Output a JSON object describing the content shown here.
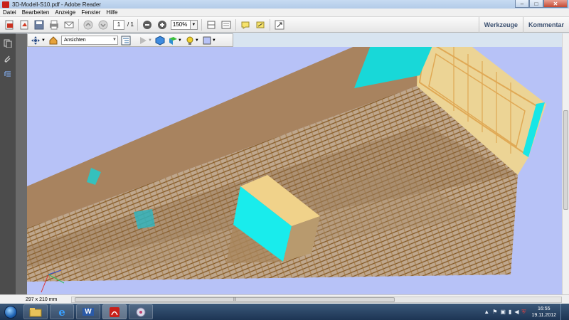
{
  "window": {
    "title": "3D-Modell-S10.pdf - Adobe Reader"
  },
  "menu": [
    "Datei",
    "Bearbeiten",
    "Anzeige",
    "Fenster",
    "Hilfe"
  ],
  "toolbar": {
    "page_current": "1",
    "page_total": "/ 1",
    "zoom": "150%",
    "tools_label": "Werkzeuge",
    "comment_label": "Kommentar"
  },
  "toolbar3d": {
    "views_label": "Ansichten"
  },
  "status": {
    "page_size": "297 x 210 mm"
  },
  "taskbar": {
    "time": "16:55",
    "date": "19.11.2012"
  },
  "colors": {
    "viewport_bg": "#b7c2f7",
    "concrete": "#c4a074",
    "rebar": "#8a5a20",
    "cyan_face": "#18e6e6",
    "taskbar": "#27426a"
  }
}
